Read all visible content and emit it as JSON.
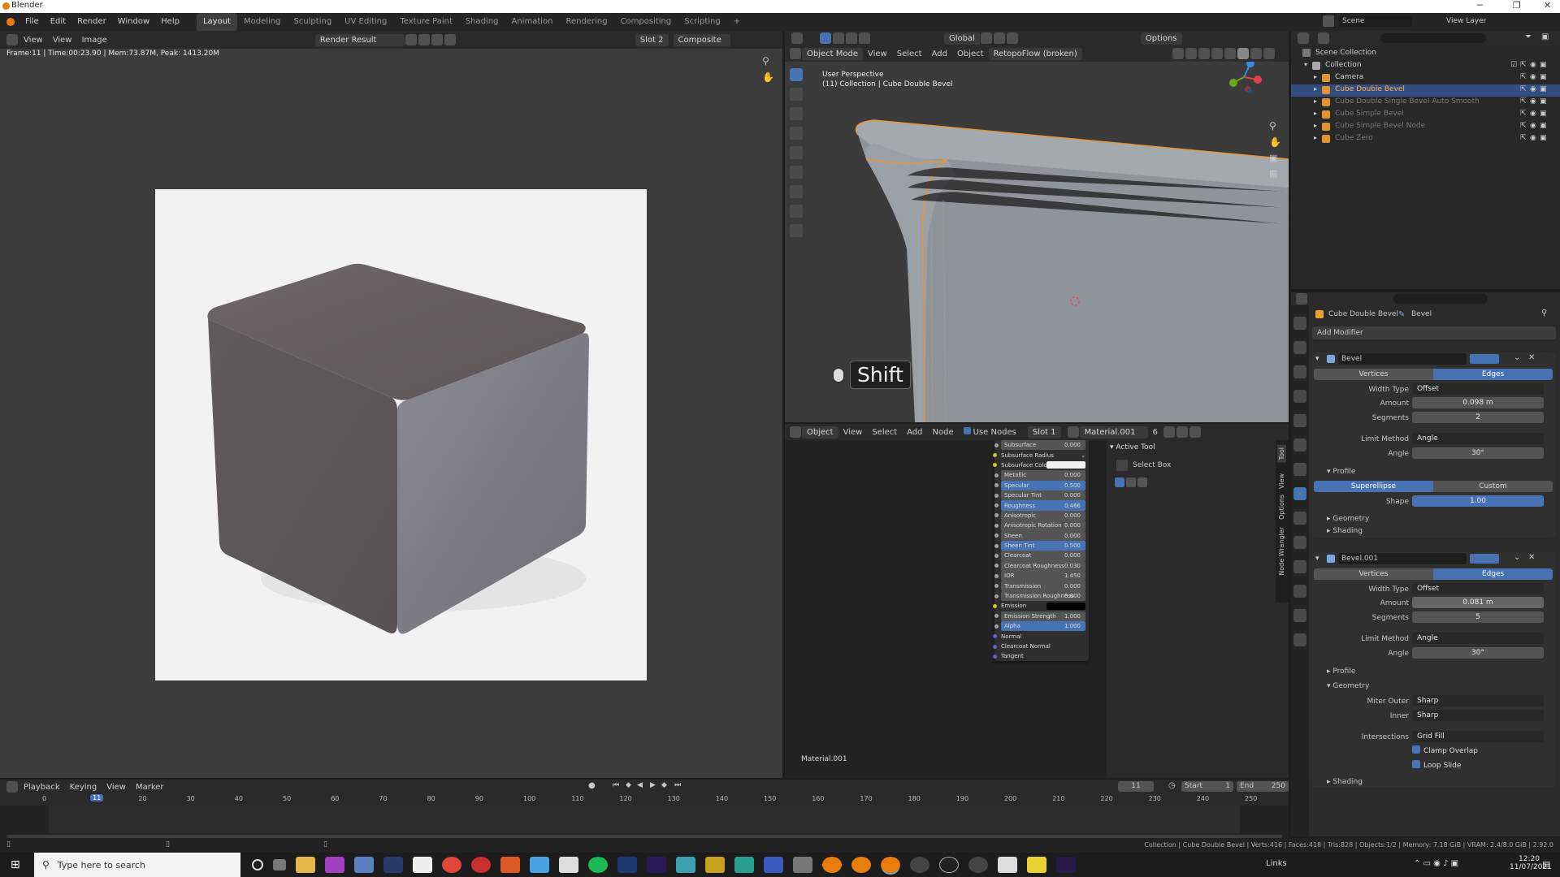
{
  "window": {
    "title": "Blender"
  },
  "menus": [
    "File",
    "Edit",
    "Render",
    "Window",
    "Help"
  ],
  "workspaces": [
    "Layout",
    "Modeling",
    "Sculpting",
    "UV Editing",
    "Texture Paint",
    "Shading",
    "Animation",
    "Rendering",
    "Compositing",
    "Scripting",
    "+"
  ],
  "top_right": {
    "scene": "Scene",
    "view_layer": "View Layer"
  },
  "image_editor": {
    "view": "View",
    "view2": "View",
    "image": "Image",
    "render_name": "Render Result",
    "slot": "Slot 2",
    "composite": "Composite",
    "info": "Frame:11 | Time:00:23.90 | Mem:73.87M, Peak: 1413.20M"
  },
  "viewport": {
    "mode": "Object Mode",
    "menu": [
      "View",
      "Select",
      "Add",
      "Object"
    ],
    "addon": "RetopoFlow (broken)",
    "orientation": "Global",
    "options": "Options",
    "persp": "User Perspective",
    "collection": "(11) Collection | Cube Double Bevel",
    "key_overlay": "Shift"
  },
  "node_editor": {
    "object": "Object",
    "menu": [
      "View",
      "Select",
      "Add",
      "Node"
    ],
    "use_nodes": "Use Nodes",
    "slot": "Slot 1",
    "material": "Material.001",
    "users": "6",
    "material_label": "Material.001",
    "active_tool_header": "Active Tool",
    "select_box": "Select Box",
    "side_tabs": [
      "Tool",
      "View",
      "Options",
      "Node Wrangler"
    ],
    "bsdf": [
      {
        "label": "Subsurface",
        "value": "0.000",
        "kind": "field"
      },
      {
        "label": "Subsurface Radius",
        "value": "",
        "kind": "dropdown"
      },
      {
        "label": "Subsurface Color",
        "value": "",
        "kind": "color-white"
      },
      {
        "label": "Metallic",
        "value": "0.000",
        "kind": "field"
      },
      {
        "label": "Specular",
        "value": "0.500",
        "kind": "field-hl"
      },
      {
        "label": "Specular Tint",
        "value": "0.000",
        "kind": "field"
      },
      {
        "label": "Roughness",
        "value": "0.466",
        "kind": "field-hl"
      },
      {
        "label": "Anisotropic",
        "value": "0.000",
        "kind": "field"
      },
      {
        "label": "Anisotropic Rotation",
        "value": "0.000",
        "kind": "field"
      },
      {
        "label": "Sheen",
        "value": "0.000",
        "kind": "field"
      },
      {
        "label": "Sheen Tint",
        "value": "0.500",
        "kind": "field-hl"
      },
      {
        "label": "Clearcoat",
        "value": "0.000",
        "kind": "field"
      },
      {
        "label": "Clearcoat Roughness",
        "value": "0.030",
        "kind": "field"
      },
      {
        "label": "IOR",
        "value": "1.450",
        "kind": "field"
      },
      {
        "label": "Transmission",
        "value": "0.000",
        "kind": "field"
      },
      {
        "label": "Transmission Roughness",
        "value": "0.000",
        "kind": "field"
      },
      {
        "label": "Emission",
        "value": "",
        "kind": "color-black"
      },
      {
        "label": "Emission Strength",
        "value": "1.000",
        "kind": "field"
      },
      {
        "label": "Alpha",
        "value": "1.000",
        "kind": "field-hl"
      },
      {
        "label": "Normal",
        "value": "",
        "kind": "socket"
      },
      {
        "label": "Clearcoat Normal",
        "value": "",
        "kind": "socket"
      },
      {
        "label": "Tangent",
        "value": "",
        "kind": "socket"
      }
    ]
  },
  "outliner": {
    "root": "Scene Collection",
    "items": [
      {
        "label": "Collection",
        "depth": 1,
        "icon": "collection-icon"
      },
      {
        "label": "Camera",
        "depth": 2,
        "icon": "camera-icon"
      },
      {
        "label": "Cube Double Bevel",
        "depth": 2,
        "icon": "mesh-icon",
        "selected": true
      },
      {
        "label": "Cube Double Single Bevel Auto Smooth",
        "depth": 2,
        "icon": "mesh-icon"
      },
      {
        "label": "Cube Simple Bevel",
        "depth": 2,
        "icon": "mesh-icon"
      },
      {
        "label": "Cube Simple Bevel Node",
        "depth": 2,
        "icon": "mesh-icon"
      },
      {
        "label": "Cube Zero",
        "depth": 2,
        "icon": "mesh-icon"
      }
    ]
  },
  "properties": {
    "object": "Cube Double Bevel",
    "modifier_tab": "Bevel",
    "add_modifier": "Add Modifier",
    "mod1": {
      "name": "Bevel",
      "seg": [
        "Vertices",
        "Edges"
      ],
      "width_type_label": "Width Type",
      "width_type": "Offset",
      "amount_label": "Amount",
      "amount": "0.098 m",
      "segments_label": "Segments",
      "segments": "2",
      "limit_label": "Limit Method",
      "limit": "Angle",
      "angle_label": "Angle",
      "angle": "30°",
      "profile": "Profile",
      "profile_seg": [
        "Superellipse",
        "Custom"
      ],
      "shape_label": "Shape",
      "shape": "1.00",
      "geometry": "Geometry",
      "shading": "Shading"
    },
    "mod2": {
      "name": "Bevel.001",
      "seg": [
        "Vertices",
        "Edges"
      ],
      "width_type_label": "Width Type",
      "width_type": "Offset",
      "amount_label": "Amount",
      "amount": "0.081 m",
      "segments_label": "Segments",
      "segments": "5",
      "limit_label": "Limit Method",
      "limit": "Angle",
      "angle_label": "Angle",
      "angle": "30°",
      "profile": "Profile",
      "geometry": "Geometry",
      "miter_outer_label": "Miter Outer",
      "miter_outer": "Sharp",
      "inner_label": "Inner",
      "inner": "Sharp",
      "intersections_label": "Intersections",
      "intersections": "Grid Fill",
      "clamp": "Clamp Overlap",
      "loop": "Loop Slide",
      "shading": "Shading"
    }
  },
  "timeline": {
    "menu": [
      "Playback",
      "Keying",
      "View",
      "Marker"
    ],
    "current": "11",
    "start_label": "Start",
    "start": "1",
    "end_label": "End",
    "end": "250",
    "ticks": [
      "0",
      "10",
      "20",
      "30",
      "40",
      "50",
      "60",
      "70",
      "80",
      "90",
      "100",
      "110",
      "120",
      "130",
      "140",
      "150",
      "160",
      "170",
      "180",
      "190",
      "200",
      "210",
      "220",
      "230",
      "240",
      "250"
    ],
    "marker": "11"
  },
  "status": {
    "text": "Collection | Cube Double Bevel | Verts:416 | Faces:418 | Tris:828 | Objects:1/2 | Memory: 7.18 GiB | VRAM: 2.4/8.0 GiB | 2.92.0"
  },
  "taskbar": {
    "search": "Type here to search",
    "links": "Links",
    "time": "12:20",
    "date": "11/07/2021"
  }
}
